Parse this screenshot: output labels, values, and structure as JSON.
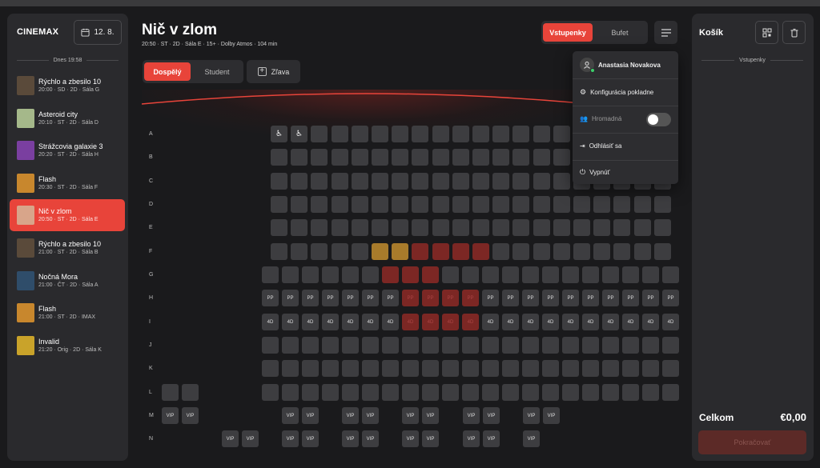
{
  "app": {
    "logo": "CINEMAX",
    "date_label": "12. 8."
  },
  "sidebar": {
    "day_label": "Dnes 19:58",
    "movies": [
      {
        "title": "Rýchlo a zbesilo 10",
        "info": "20:00 · SD · 2D · Sála G",
        "poster": "#5a4a3a"
      },
      {
        "title": "Asteroid city",
        "info": "20:10 · ST · 2D · Sála D",
        "poster": "#a5b88a"
      },
      {
        "title": "Strážcovia galaxie 3",
        "info": "20:20 · ST · 2D · Sála H",
        "poster": "#7a3fa0"
      },
      {
        "title": "Flash",
        "info": "20:30 · ST · 2D · Sála F",
        "poster": "#c8872d"
      },
      {
        "title": "Nič v zlom",
        "info": "20:50 · ST · 2D · Sála E",
        "poster": "#d8a58a"
      },
      {
        "title": "Rýchlo a zbesilo 10",
        "info": "21:00 · ST · 2D · Sála B",
        "poster": "#5a4a3a"
      },
      {
        "title": "Nočná Mora",
        "info": "21:00 · ČT · 2D · Sála A",
        "poster": "#2f4d6a"
      },
      {
        "title": "Flash",
        "info": "21:00 · ST · 2D · IMAX",
        "poster": "#c8872d"
      },
      {
        "title": "Invalid",
        "info": "21:20 · Orig · 2D · Sála K",
        "poster": "#c9a32a"
      }
    ],
    "active_index": 4
  },
  "header": {
    "title": "Nič v zlom",
    "subtitle": "20:50 · ST · 2D · Sála E · 15+ · Dolby Atmos · 104 min"
  },
  "ticket_types": {
    "adult": "Dospělý",
    "student": "Student",
    "discount": "Zľava"
  },
  "mode_tabs": {
    "tickets": "Vstupenky",
    "buffet": "Bufet"
  },
  "menu": {
    "user": "Anastasia Novakova",
    "config": "Konfigurácia pokladne",
    "bulk": "Hromadná",
    "bulk_on": false,
    "logout": "Odhlásiť sa",
    "shutdown": "Vypnúť"
  },
  "cart": {
    "title": "Košík",
    "section": "Vstupenky",
    "total_label": "Celkom",
    "total_value": "€0,00",
    "continue": "Pokračovať"
  },
  "hall": {
    "rows": [
      "A",
      "B",
      "C",
      "D",
      "E",
      "F",
      "G",
      "H",
      "I",
      "J",
      "K",
      "L",
      "M",
      "N"
    ],
    "seat_labels": {
      "pp": "PP",
      "fourd": "4D",
      "vip": "VIP",
      "wheelchair": "♿"
    }
  },
  "colors": {
    "accent": "#e8443a",
    "seat": "#3d3d40",
    "sold": "#7c2724",
    "selected": "#a87b2b"
  }
}
